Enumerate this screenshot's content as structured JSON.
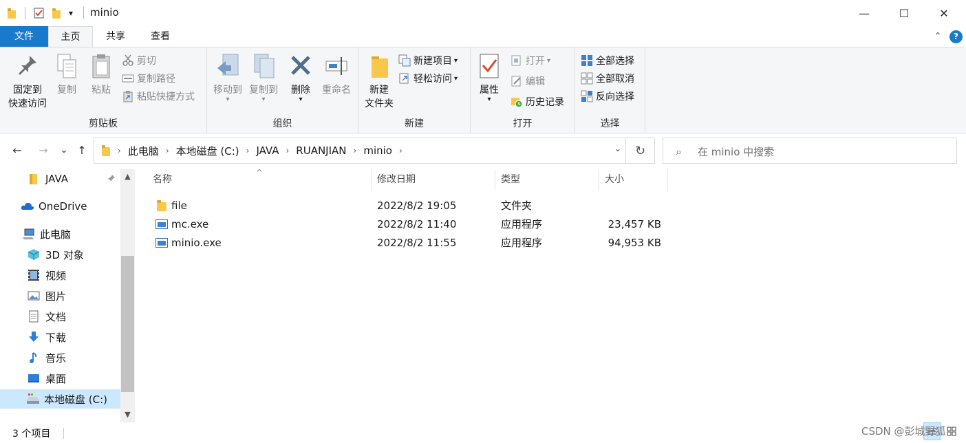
{
  "window": {
    "title": "minio",
    "minimize_glyph": "—",
    "maximize_glyph": "☐",
    "close_glyph": "✕",
    "qat_dropdown_glyph": "▾"
  },
  "ribbon_tabs": {
    "file": "文件",
    "home": "主页",
    "share": "共享",
    "view": "查看",
    "collapse_glyph": "⌃",
    "help_glyph": "?"
  },
  "ribbon": {
    "clipboard": {
      "label": "剪贴板",
      "pin_line1": "固定到",
      "pin_line2": "快速访问",
      "copy": "复制",
      "paste": "粘贴",
      "cut": "剪切",
      "copy_path": "复制路径",
      "paste_shortcut": "粘贴快捷方式"
    },
    "organize": {
      "label": "组织",
      "move_to": "移动到",
      "copy_to": "复制到",
      "delete": "删除",
      "rename": "重命名"
    },
    "new": {
      "label": "新建",
      "new_folder_line1": "新建",
      "new_folder_line2": "文件夹",
      "new_item": "新建项目",
      "easy_access": "轻松访问"
    },
    "open": {
      "label": "打开",
      "properties": "属性",
      "open": "打开",
      "edit": "编辑",
      "history": "历史记录"
    },
    "select": {
      "label": "选择",
      "select_all": "全部选择",
      "select_none": "全部取消",
      "invert": "反向选择"
    }
  },
  "navigation": {
    "back_glyph": "←",
    "forward_glyph": "→",
    "recent_glyph": "⌄",
    "up_glyph": "↑",
    "breadcrumbs": [
      "此电脑",
      "本地磁盘 (C:)",
      "JAVA",
      "RUANJIAN",
      "minio"
    ],
    "chevron_glyph": "›",
    "dropdown_glyph": "⌄",
    "refresh_glyph": "↻"
  },
  "search": {
    "placeholder": "在 minio 中搜索",
    "icon_glyph": "⌕"
  },
  "sidebar": {
    "items": [
      {
        "label": "JAVA",
        "icon": "folder-icon",
        "pinned": true
      },
      {
        "label": "OneDrive",
        "icon": "cloud-icon"
      },
      {
        "label": "此电脑",
        "icon": "computer-icon"
      },
      {
        "label": "3D 对象",
        "icon": "3d-objects-icon"
      },
      {
        "label": "视频",
        "icon": "video-icon"
      },
      {
        "label": "图片",
        "icon": "pictures-icon"
      },
      {
        "label": "文档",
        "icon": "documents-icon"
      },
      {
        "label": "下载",
        "icon": "download-icon"
      },
      {
        "label": "音乐",
        "icon": "music-icon"
      },
      {
        "label": "桌面",
        "icon": "desktop-icon"
      },
      {
        "label": "本地磁盘 (C:)",
        "icon": "drive-icon",
        "selected": true
      }
    ],
    "pin_glyph": "📌",
    "scroll_up_glyph": "▲",
    "scroll_down_glyph": "▼"
  },
  "file_list": {
    "columns": {
      "name": "名称",
      "modified": "修改日期",
      "type": "类型",
      "size": "大小",
      "sort_glyph": "^"
    },
    "rows": [
      {
        "name": "file",
        "modified": "2022/8/2 19:05",
        "type": "文件夹",
        "size": "",
        "icon": "folder-icon"
      },
      {
        "name": "mc.exe",
        "modified": "2022/8/2 11:40",
        "type": "应用程序",
        "size": "23,457 KB",
        "icon": "exe-icon"
      },
      {
        "name": "minio.exe",
        "modified": "2022/8/2 11:55",
        "type": "应用程序",
        "size": "94,953 KB",
        "icon": "exe-icon"
      }
    ]
  },
  "status_bar": {
    "item_count": "3 个项目"
  },
  "watermark": "CSDN @彭城野狐"
}
